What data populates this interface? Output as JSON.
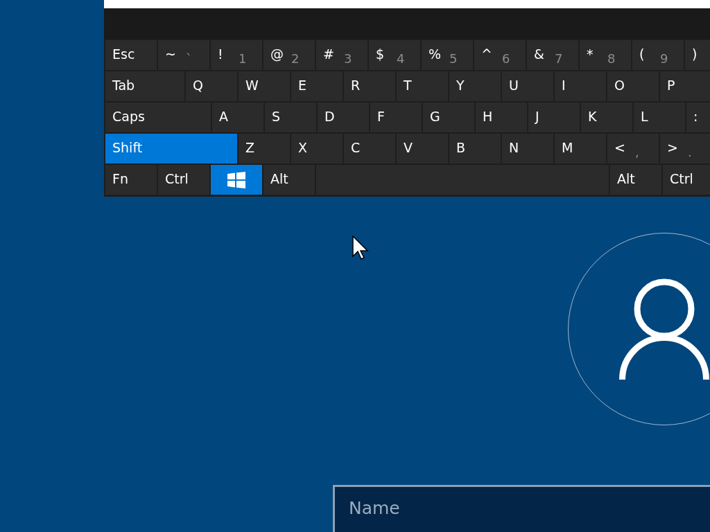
{
  "keyboard": {
    "rows": [
      {
        "keys": [
          {
            "kind": "key",
            "label": "Esc",
            "active": false
          },
          {
            "kind": "key",
            "label": "~",
            "secondary": "`",
            "active": false
          },
          {
            "kind": "key",
            "label": "!",
            "secondary": "1",
            "active": false
          },
          {
            "kind": "key",
            "label": "@",
            "secondary": "2",
            "active": false
          },
          {
            "kind": "key",
            "label": "#",
            "secondary": "3",
            "active": false
          },
          {
            "kind": "key",
            "label": "$",
            "secondary": "4",
            "active": false
          },
          {
            "kind": "key",
            "label": "%",
            "secondary": "5",
            "active": false
          },
          {
            "kind": "key",
            "label": "^",
            "secondary": "6",
            "active": false
          },
          {
            "kind": "key",
            "label": "&",
            "secondary": "7",
            "active": false
          },
          {
            "kind": "key",
            "label": "*",
            "secondary": "8",
            "active": false
          },
          {
            "kind": "key",
            "label": "(",
            "secondary": "9",
            "active": false
          },
          {
            "kind": "key",
            "label": ")",
            "active": false
          }
        ]
      },
      {
        "keys": [
          {
            "kind": "tab",
            "label": "Tab",
            "active": false
          },
          {
            "kind": "key",
            "label": "Q",
            "active": false
          },
          {
            "kind": "key",
            "label": "W",
            "active": false
          },
          {
            "kind": "key",
            "label": "E",
            "active": false
          },
          {
            "kind": "key",
            "label": "R",
            "active": false
          },
          {
            "kind": "key",
            "label": "T",
            "active": false
          },
          {
            "kind": "key",
            "label": "Y",
            "active": false
          },
          {
            "kind": "key",
            "label": "U",
            "active": false
          },
          {
            "kind": "key",
            "label": "I",
            "active": false
          },
          {
            "kind": "key",
            "label": "O",
            "active": false
          },
          {
            "kind": "key",
            "label": "P",
            "active": false
          }
        ]
      },
      {
        "keys": [
          {
            "kind": "caps",
            "label": "Caps",
            "active": false
          },
          {
            "kind": "key",
            "label": "A",
            "active": false
          },
          {
            "kind": "key",
            "label": "S",
            "active": false
          },
          {
            "kind": "key",
            "label": "D",
            "active": false
          },
          {
            "kind": "key",
            "label": "F",
            "active": false
          },
          {
            "kind": "key",
            "label": "G",
            "active": false
          },
          {
            "kind": "key",
            "label": "H",
            "active": false
          },
          {
            "kind": "key",
            "label": "J",
            "active": false
          },
          {
            "kind": "key",
            "label": "K",
            "active": false
          },
          {
            "kind": "key",
            "label": "L",
            "active": false
          },
          {
            "kind": "key",
            "label": ":",
            "active": false
          }
        ]
      },
      {
        "keys": [
          {
            "kind": "shift",
            "label": "Shift",
            "active": true
          },
          {
            "kind": "key",
            "label": "Z",
            "active": false
          },
          {
            "kind": "key",
            "label": "X",
            "active": false
          },
          {
            "kind": "key",
            "label": "C",
            "active": false
          },
          {
            "kind": "key",
            "label": "V",
            "active": false
          },
          {
            "kind": "key",
            "label": "B",
            "active": false
          },
          {
            "kind": "key",
            "label": "N",
            "active": false
          },
          {
            "kind": "key",
            "label": "M",
            "active": false
          },
          {
            "kind": "key",
            "label": "<",
            "secondary": ",",
            "active": false
          },
          {
            "kind": "key",
            "label": ">",
            "secondary": ".",
            "active": false
          }
        ]
      },
      {
        "keys": [
          {
            "kind": "key",
            "label": "Fn",
            "active": false
          },
          {
            "kind": "key",
            "label": "Ctrl",
            "active": false
          },
          {
            "kind": "windows",
            "active": true
          },
          {
            "kind": "key",
            "label": "Alt",
            "active": false
          },
          {
            "kind": "space",
            "active": false
          },
          {
            "kind": "key",
            "label": "Alt",
            "active": false
          },
          {
            "kind": "key",
            "label": "Ctrl",
            "active": false
          }
        ]
      }
    ]
  },
  "name_field": {
    "placeholder": "Name"
  }
}
